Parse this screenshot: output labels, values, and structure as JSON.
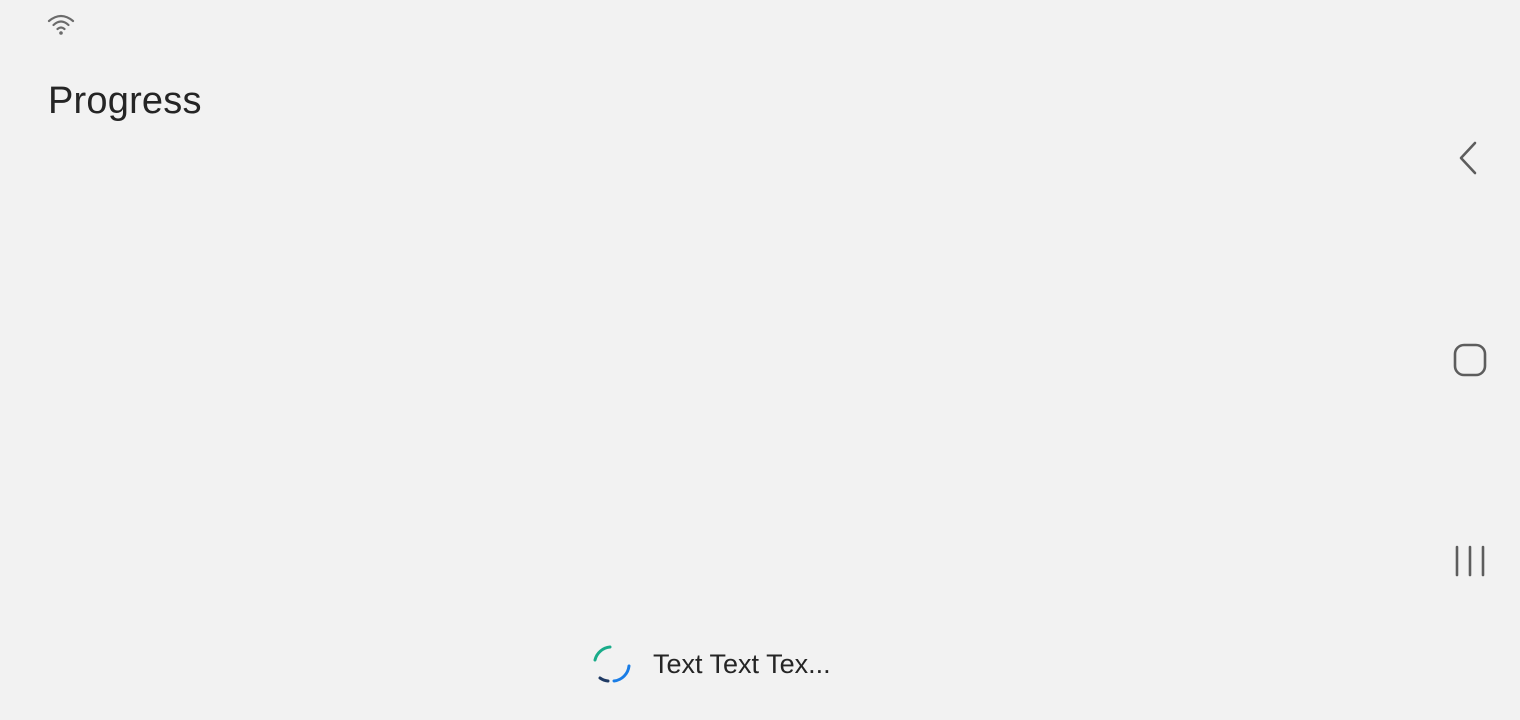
{
  "status_bar": {
    "icons": [
      "wifi-icon"
    ]
  },
  "page": {
    "title": "Progress"
  },
  "progress": {
    "text": "Text Text Tex...",
    "indicator": "circular-indeterminate",
    "colors": {
      "arc_primary": "#1a7de6",
      "arc_secondary": "#1aac8a"
    }
  },
  "navigation_bar": {
    "buttons": [
      {
        "icon": "back-icon"
      },
      {
        "icon": "home-icon"
      },
      {
        "icon": "recents-icon"
      }
    ]
  },
  "colors": {
    "background": "#f2f2f2",
    "text": "#252525",
    "icon": "#5d5d5d"
  }
}
